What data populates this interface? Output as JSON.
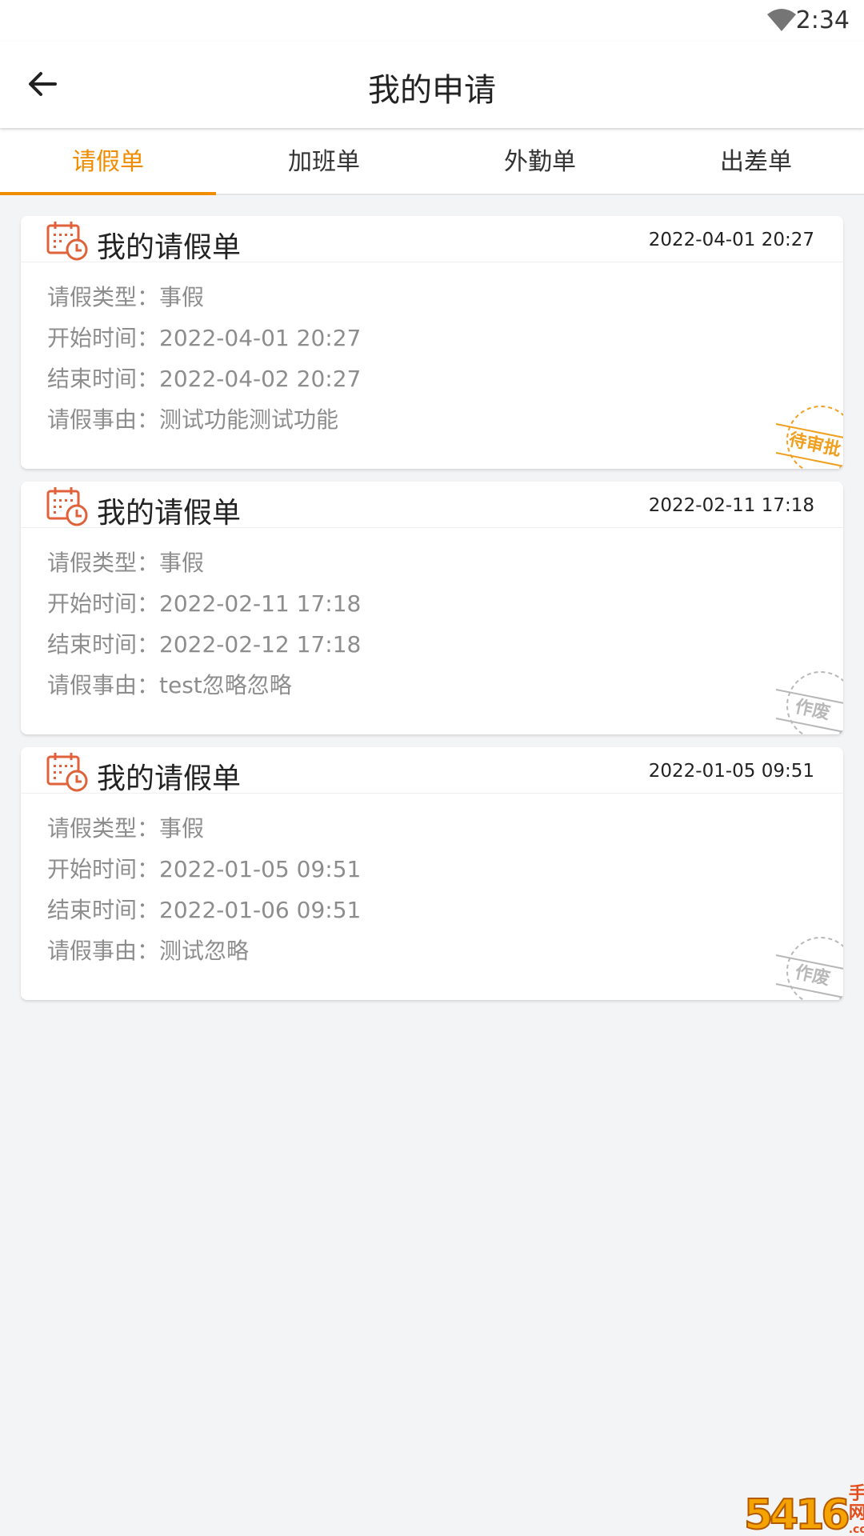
{
  "status_bar": {
    "time": "2:34"
  },
  "app_bar": {
    "title": "我的申请"
  },
  "tabs": [
    {
      "label": "请假单",
      "active": true
    },
    {
      "label": "加班单",
      "active": false
    },
    {
      "label": "外勤单",
      "active": false
    },
    {
      "label": "出差单",
      "active": false
    }
  ],
  "cards": [
    {
      "title": "我的请假单",
      "date": "2022-04-01 20:27",
      "rows": [
        {
          "label": "请假类型：",
          "value": "事假"
        },
        {
          "label": "开始时间：",
          "value": "2022-04-01 20:27"
        },
        {
          "label": "结束时间：",
          "value": "2022-04-02 20:27"
        },
        {
          "label": "请假事由：",
          "value": "测试功能测试功能"
        }
      ],
      "stamp": {
        "text": "待审批",
        "color": "#f0a020"
      }
    },
    {
      "title": "我的请假单",
      "date": "2022-02-11 17:18",
      "rows": [
        {
          "label": "请假类型：",
          "value": "事假"
        },
        {
          "label": "开始时间：",
          "value": "2022-02-11 17:18"
        },
        {
          "label": "结束时间：",
          "value": "2022-02-12 17:18"
        },
        {
          "label": "请假事由：",
          "value": "test忽略忽略"
        }
      ],
      "stamp": {
        "text": "作废",
        "color": "#b8b8b8"
      }
    },
    {
      "title": "我的请假单",
      "date": "2022-01-05 09:51",
      "rows": [
        {
          "label": "请假类型：",
          "value": "事假"
        },
        {
          "label": "开始时间：",
          "value": "2022-01-05 09:51"
        },
        {
          "label": "结束时间：",
          "value": "2022-01-06 09:51"
        },
        {
          "label": "请假事由：",
          "value": "测试忽略"
        }
      ],
      "stamp": {
        "text": "作废",
        "color": "#b8b8b8"
      }
    }
  ],
  "watermark": {
    "number": "5416",
    "site_cn": "手游网",
    "site_en": ".com.cn"
  },
  "colors": {
    "accent": "#f08c00",
    "icon": "#e0623a",
    "background": "#f3f4f6"
  }
}
